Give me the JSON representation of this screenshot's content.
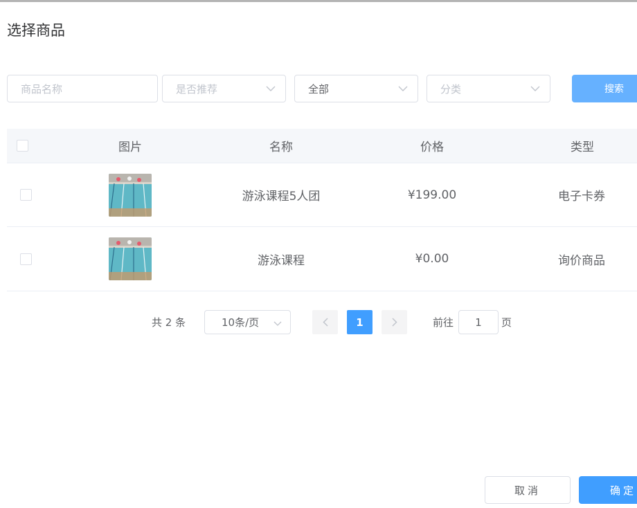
{
  "dialog": {
    "title": "选择商品"
  },
  "filters": {
    "name_placeholder": "商品名称",
    "recommend_placeholder": "是否推荐",
    "status_value": "全部",
    "category_placeholder": "分类",
    "search_label": "搜索"
  },
  "table": {
    "columns": [
      "图片",
      "名称",
      "价格",
      "类型"
    ],
    "rows": [
      {
        "name": "游泳课程5人团",
        "price": "¥199.00",
        "type": "电子卡券",
        "image_icon": "pool-photo"
      },
      {
        "name": "游泳课程",
        "price": "¥0.00",
        "type": "询价商品",
        "image_icon": "pool-photo"
      }
    ]
  },
  "pagination": {
    "total_text": "共 2 条",
    "page_size": "10条/页",
    "current_page": "1",
    "goto_prefix": "前往",
    "goto_value": "1",
    "goto_suffix": "页"
  },
  "footer": {
    "cancel_label": "取消",
    "confirm_label": "确定"
  },
  "colors": {
    "primary": "#409eff",
    "primary_light": "#66b1ff",
    "border": "#dcdfe6",
    "header_bg": "#f5f7fa"
  }
}
